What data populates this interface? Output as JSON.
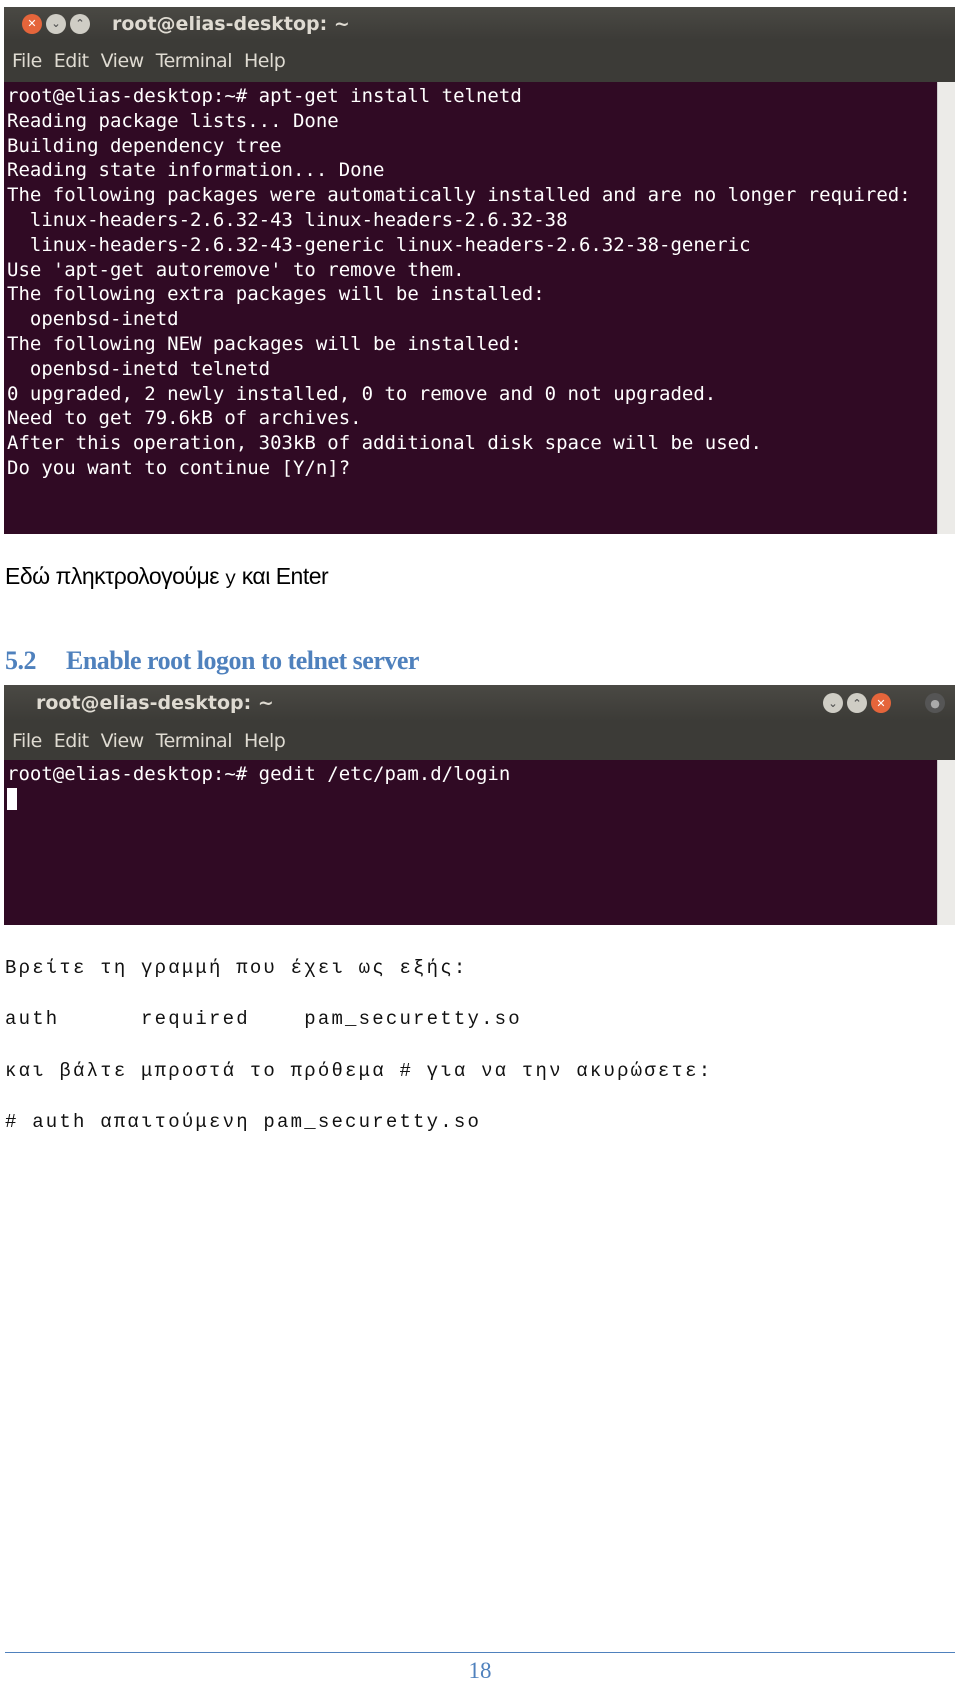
{
  "terminal1": {
    "title": "root@elias-desktop: ~",
    "menu": [
      "File",
      "Edit",
      "View",
      "Terminal",
      "Help"
    ],
    "lines": [
      "root@elias-desktop:~# apt-get install telnetd",
      "Reading package lists... Done",
      "Building dependency tree",
      "Reading state information... Done",
      "The following packages were automatically installed and are no longer required:",
      "  linux-headers-2.6.32-43 linux-headers-2.6.32-38",
      "  linux-headers-2.6.32-43-generic linux-headers-2.6.32-38-generic",
      "Use 'apt-get autoremove' to remove them.",
      "The following extra packages will be installed:",
      "  openbsd-inetd",
      "The following NEW packages will be installed:",
      "  openbsd-inetd telnetd",
      "0 upgraded, 2 newly installed, 0 to remove and 0 not upgraded.",
      "Need to get 79.6kB of archives.",
      "After this operation, 303kB of additional disk space will be used.",
      "Do you want to continue [Y/n]?"
    ]
  },
  "instruction": {
    "before": "Εδώ πληκτρολογούμε",
    "key": "y",
    "after": "και Enter"
  },
  "heading": {
    "number": "5.2",
    "title": "Enable root logon to telnet server"
  },
  "terminal2": {
    "title": "root@elias-desktop: ~",
    "menu": [
      "File",
      "Edit",
      "View",
      "Terminal",
      "Help"
    ],
    "lines": [
      "root@elias-desktop:~# gedit /etc/pam.d/login"
    ]
  },
  "paragraphs": [
    "Βρείτε τη γραμμή που έχει ως εξής:",
    "auth      required    pam_securetty.so",
    "και βάλτε μπροστά το πρόθεμα # για να την ακυρώσετε:",
    "# auth απαιτούμενη pam_securetty.so"
  ],
  "page_number": "18"
}
